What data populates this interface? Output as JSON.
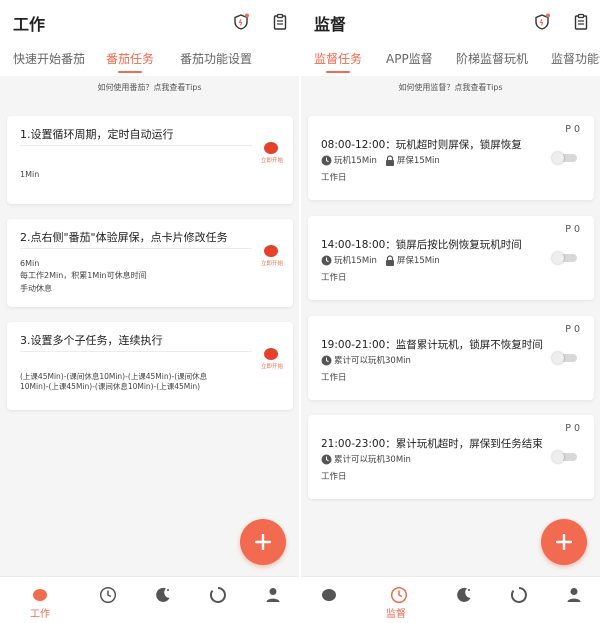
{
  "colors": {
    "accent": "#f26a4f",
    "icon_gray": "#555555",
    "background": "#f5f5f5"
  },
  "left": {
    "title": "工作",
    "tabs": [
      {
        "label": "快速开始番茄",
        "active": false
      },
      {
        "label": "番茄任务",
        "active": true
      },
      {
        "label": "番茄功能设置",
        "active": false
      }
    ],
    "tips": "如何使用番茄？点我查看Tips",
    "cards": [
      {
        "title": "1.设置循环周期，定时自动运行",
        "start_label": "立即开始",
        "lines": [
          "1Min"
        ]
      },
      {
        "title": "2.点右侧\"番茄\"体验屏保，点卡片修改任务",
        "start_label": "立即开始",
        "lines": [
          "6Min",
          "每工作2Min，积累1Min可休息时间",
          "手动休息"
        ]
      },
      {
        "title": "3.设置多个子任务，连续执行",
        "start_label": "立即开始",
        "lines": [
          "(上课45Min)-(课间休息10Min)-(上课45Min)-(课间休息",
          "10Min)-(上课45Min)-(课间休息10Min)-(上课45Min)"
        ]
      }
    ],
    "nav": {
      "active_label": "工作",
      "items": [
        "tomato-icon",
        "clock-icon",
        "moon-icon",
        "circle-icon",
        "person-icon"
      ]
    }
  },
  "right": {
    "title": "监督",
    "tabs": [
      {
        "label": "监督任务",
        "active": true
      },
      {
        "label": "APP监督",
        "active": false
      },
      {
        "label": "阶梯监督玩机",
        "active": false
      },
      {
        "label": "监督功能设",
        "active": false
      }
    ],
    "tips": "如何使用监督？点我查看Tips",
    "cards": [
      {
        "time": "08:00-12:00：玩机超时则屏保，锁屏恢复",
        "priority": "P 0",
        "play": "玩机15Min",
        "lock": "屏保15Min",
        "day": "工作日",
        "enabled": false
      },
      {
        "time": "14:00-18:00：锁屏后按比例恢复玩机时间",
        "priority": "P 0",
        "play": "玩机15Min",
        "lock": "屏保15Min",
        "day": "工作日",
        "enabled": false
      },
      {
        "time": "19:00-21:00：监督累计玩机，锁屏不恢复时间",
        "priority": "P 0",
        "play": "累计可以玩机30Min",
        "lock": "",
        "day": "工作日",
        "enabled": false
      },
      {
        "time": "21:00-23:00：累计玩机超时，屏保到任务结束",
        "priority": "P 0",
        "play": "累计可以玩机30Min",
        "lock": "",
        "day": "工作日",
        "enabled": false
      }
    ],
    "nav": {
      "active_label": "监督",
      "items": [
        "tomato-icon",
        "clock-icon",
        "moon-icon",
        "circle-icon",
        "person-icon"
      ]
    }
  }
}
